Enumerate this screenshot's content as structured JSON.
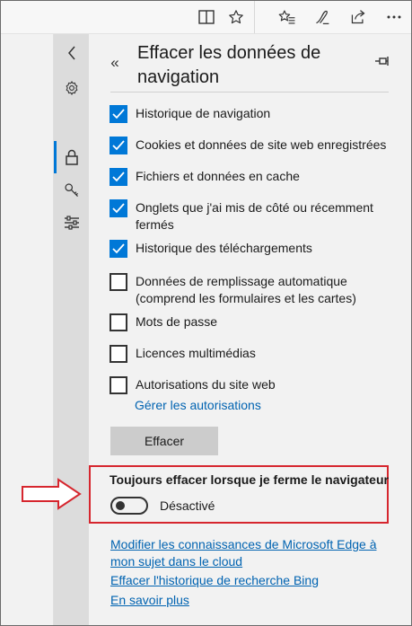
{
  "panel": {
    "title": "Effacer les données de navigation"
  },
  "checkboxes": [
    {
      "label": "Historique de navigation",
      "checked": true
    },
    {
      "label": "Cookies et données de site web enregistrées",
      "checked": true
    },
    {
      "label": "Fichiers et données en cache",
      "checked": true
    },
    {
      "label": "Onglets que j'ai mis de côté ou récemment fermés",
      "checked": true
    },
    {
      "label": "Historique des téléchargements",
      "checked": true
    },
    {
      "label": "Données de remplissage automatique (comprend les formulaires et les cartes)",
      "checked": false
    },
    {
      "label": "Mots de passe",
      "checked": false
    },
    {
      "label": "Licences multimédias",
      "checked": false
    },
    {
      "label": "Autorisations du site web",
      "checked": false
    }
  ],
  "manage_permissions_link": "Gérer les autorisations",
  "clear_button": "Effacer",
  "always_clear": {
    "label": "Toujours effacer lorsque je ferme le navigateur",
    "state": "Désactivé",
    "on": false
  },
  "footer_links": [
    "Modifier les connaissances de Microsoft Edge à mon sujet dans le cloud",
    "Effacer l'historique de recherche Bing",
    "En savoir plus"
  ],
  "colors": {
    "accent": "#0078d7",
    "link": "#0063b1",
    "highlight_red": "#d6262e"
  },
  "icons": {
    "toolbar": [
      "reading-view-icon",
      "favorite-star-icon",
      "favorites-hub-icon",
      "web-note-pen-icon",
      "share-icon",
      "more-dots-icon"
    ],
    "rail": [
      "back-chevron-icon",
      "gear-icon",
      "lock-icon",
      "key-icon",
      "sliders-icon"
    ]
  }
}
